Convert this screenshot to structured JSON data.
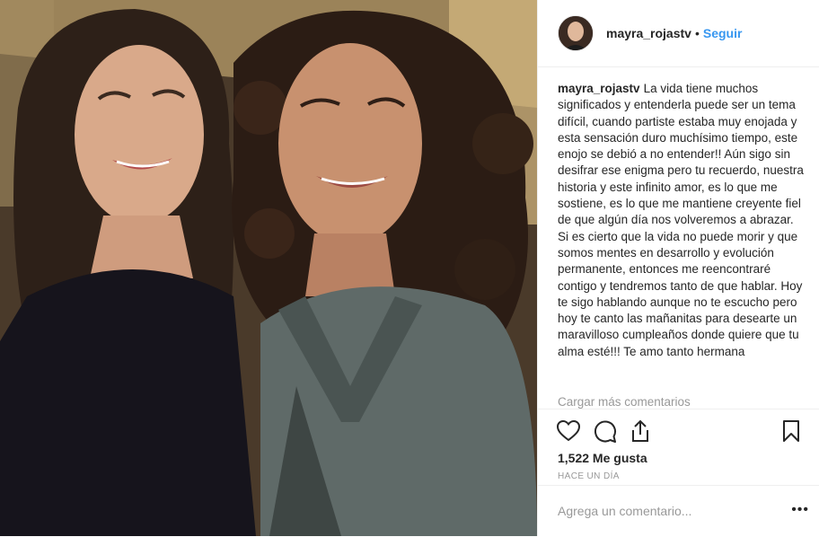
{
  "post": {
    "username": "mayra_rojastv",
    "separator": "•",
    "follow_label": "Seguir",
    "caption_user": "mayra_rojastv",
    "caption_text": "La vida tiene muchos significados y entenderla puede ser un tema difícil, cuando partiste estaba muy enojada y esta sensación duro muchísimo tiempo, este enojo se debió a no entender!! Aún sigo sin desifrar ese enigma pero tu recuerdo, nuestra historia y este infinito amor, es lo que me sostiene, es lo que me mantiene creyente fiel de que algún día nos volveremos a abrazar. Si es cierto que la vida no puede morir y que somos mentes en desarrollo y evolución permanente, entonces me reencontraré contigo y tendremos tanto de que hablar. Hoy te sigo hablando aunque no te escucho pero hoy te canto las mañanitas para desearte un maravilloso cumpleaños donde quiere que tu alma esté!!! Te amo tanto hermana",
    "load_more_label": "Cargar más comentarios",
    "likes": "1,522 Me gusta",
    "timestamp": "Hace un día",
    "comment_placeholder": "Agrega un comentario...",
    "more_options": "•••"
  },
  "icons": {
    "like": "heart-icon",
    "comment": "comment-icon",
    "share": "share-icon",
    "save": "bookmark-icon"
  },
  "colors": {
    "link_blue": "#3897f0",
    "text": "#262626",
    "muted": "#999999",
    "border": "#efefef"
  }
}
